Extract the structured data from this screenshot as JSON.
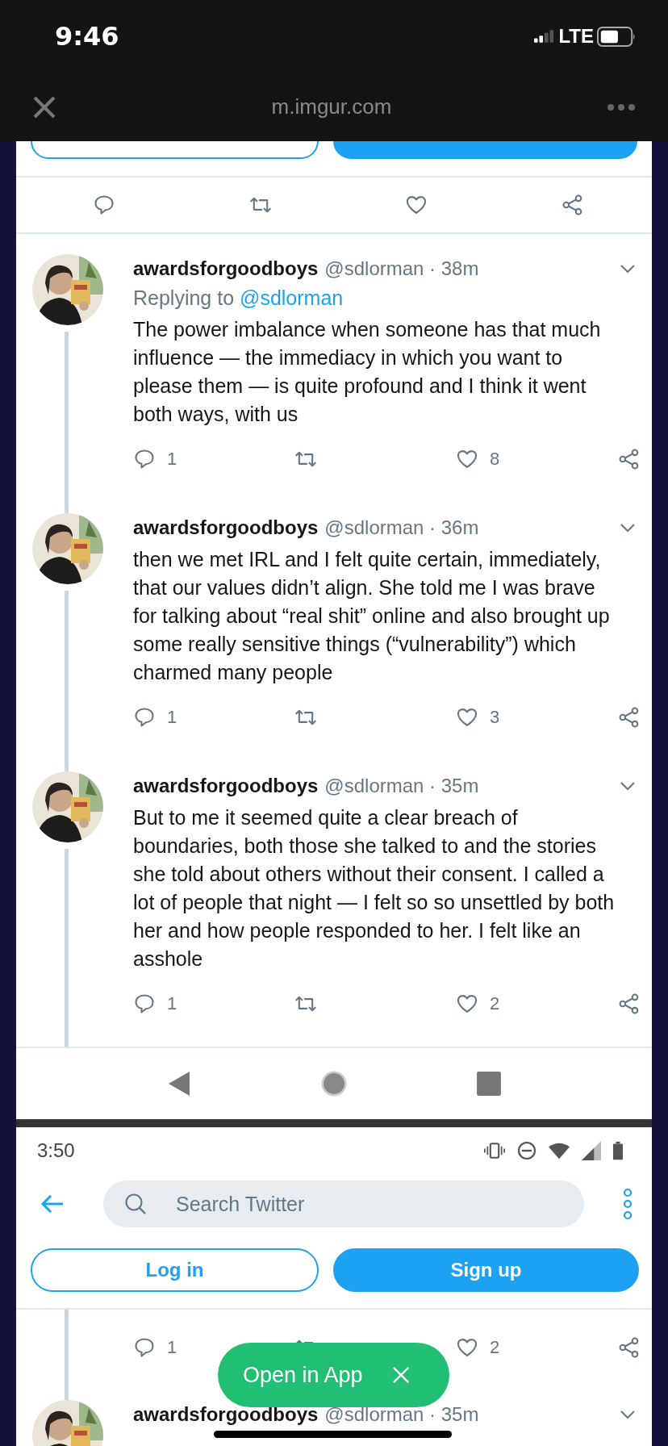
{
  "status_bar": {
    "time": "9:46",
    "network": "LTE"
  },
  "browser_bar": {
    "url": "m.imgur.com"
  },
  "tweets": [
    {
      "author": "awardsforgoodboys",
      "meta": "@sdlorman · 38m",
      "replying_label": "Replying to",
      "replying_handle": "@sdlorman",
      "text": "The power imbalance when someone has that much influence — the immediacy in which you want to please them — is quite profound and I think it went both ways, with us",
      "replies": "1",
      "likes": "8"
    },
    {
      "author": "awardsforgoodboys",
      "meta": "@sdlorman · 36m",
      "text": "then we met IRL and I felt quite certain, immediately, that our values didn’t align. She told me I was brave for talking about “real shit” online and also brought up some really sensitive things (“vulnerability”) which charmed many people",
      "replies": "1",
      "likes": "3"
    },
    {
      "author": "awardsforgoodboys",
      "meta": "@sdlorman · 35m",
      "text": "But to me it seemed quite a clear breach of boundaries, both those she talked to and the stories she told about others without their consent. I called a lot of people that night — I felt so so unsettled by both her and how people responded to her. I felt like an asshole",
      "replies": "1",
      "likes": "2"
    }
  ],
  "second_screenshot": {
    "time": "3:50",
    "search": {
      "placeholder": "Search Twitter"
    },
    "login_button": "Log in",
    "signup_button": "Sign up",
    "actions": {
      "replies": "1",
      "likes": "2"
    },
    "tweet": {
      "author": "awardsforgoodboys",
      "meta": "@sdlorman · 35m"
    }
  },
  "open_in_app": {
    "label": "Open in App"
  }
}
